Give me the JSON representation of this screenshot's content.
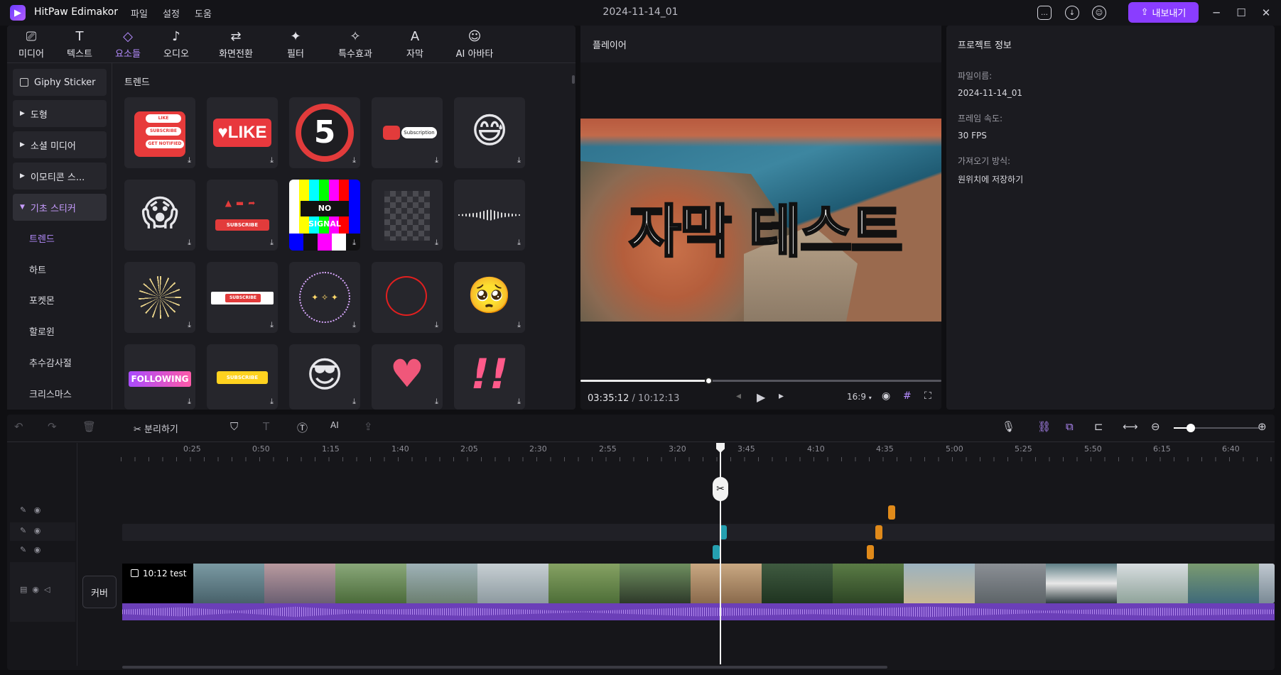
{
  "app": {
    "name": "HitPaw Edimakor",
    "doc_title": "2024-11-14_01",
    "export_label": "내보내기"
  },
  "menu": [
    "파일",
    "설정",
    "도움"
  ],
  "tabs": [
    {
      "label": "미디어",
      "icon": "media-icon"
    },
    {
      "label": "텍스트",
      "icon": "text-icon"
    },
    {
      "label": "요소들",
      "icon": "elements-icon",
      "active": true
    },
    {
      "label": "오디오",
      "icon": "audio-icon"
    },
    {
      "label": "화면전환",
      "icon": "transition-icon"
    },
    {
      "label": "필터",
      "icon": "filter-icon"
    },
    {
      "label": "특수효과",
      "icon": "effects-icon"
    },
    {
      "label": "자막",
      "icon": "subtitle-icon"
    },
    {
      "label": "AI 아바타",
      "icon": "ai-avatar-icon"
    }
  ],
  "sidebar": {
    "categories": [
      "Giphy Sticker",
      "도형",
      "소셜 미디어",
      "이모티콘 스...",
      "기초 스티커"
    ],
    "subcategories": [
      "트렌드",
      "하트",
      "포켓몬",
      "할로윈",
      "추수감사절",
      "크리스마스"
    ]
  },
  "grid": {
    "title": "트렌드",
    "tiles": [
      {
        "name": "like-subscribe-notify-sticker",
        "text": "LIKE · SUBSCRIBE · GET NOTIFIED"
      },
      {
        "name": "like-heart-sticker",
        "text": "♥LIKE"
      },
      {
        "name": "countdown-5-sticker",
        "text": "5"
      },
      {
        "name": "youtube-subscription-sticker",
        "text": "Subscription"
      },
      {
        "name": "sweat-smile-emoji",
        "text": "😅"
      },
      {
        "name": "screaming-emoji",
        "text": "😱"
      },
      {
        "name": "subscribe-bar-sticker",
        "text": "SUBSCRIBE"
      },
      {
        "name": "no-signal-sticker",
        "text": "NO SIGNAL"
      },
      {
        "name": "pixel-mosaic-sticker",
        "text": ""
      },
      {
        "name": "sound-wave-sticker",
        "text": ""
      },
      {
        "name": "fireworks-sticker",
        "text": ""
      },
      {
        "name": "subscribe-button-sticker",
        "text": "SUBSCRIBE"
      },
      {
        "name": "stars-circle-sticker",
        "text": ""
      },
      {
        "name": "red-circle-sticker",
        "text": ""
      },
      {
        "name": "pleading-emoji",
        "text": "🥺"
      },
      {
        "name": "following-button-sticker",
        "text": "FOLLOWING"
      },
      {
        "name": "subscribe-yellow-sticker",
        "text": "SUBSCRIBE"
      },
      {
        "name": "sunglasses-emoji",
        "text": "😎"
      },
      {
        "name": "hearts-sticker",
        "text": "♥"
      },
      {
        "name": "exclamation-sticker",
        "text": "!!"
      }
    ]
  },
  "player": {
    "title": "플레이어",
    "subtitle_text": "자막 테스트",
    "current_time": "03:35:12",
    "total_time": "/ 10:12:13",
    "progress": 0.355,
    "aspect": "16:9"
  },
  "project_info": {
    "title": "프로젝트 정보",
    "file_name_label": "파일이름:",
    "file_name": "2024-11-14_01",
    "frame_rate_label": "프레임 속도:",
    "frame_rate": "30 FPS",
    "import_label": "가져오기 방식:",
    "import_value": "원위치에 저장하기"
  },
  "timeline": {
    "split_label": "분리하기",
    "ticks": [
      "0:25",
      "0:50",
      "1:15",
      "1:40",
      "2:05",
      "2:30",
      "2:55",
      "3:20",
      "3:45",
      "4:10",
      "4:35",
      "5:00",
      "5:25",
      "5:50",
      "6:15",
      "6:40"
    ],
    "cover_label": "커버",
    "clip_label": "10:12 test"
  }
}
